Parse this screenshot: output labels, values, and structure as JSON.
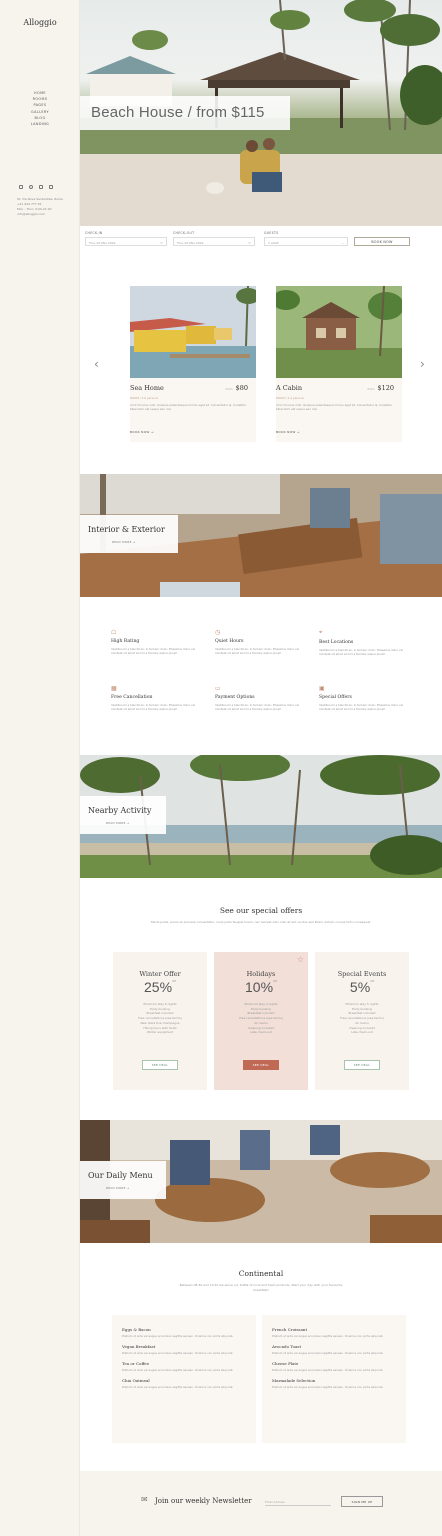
{
  "sidebar": {
    "logo": "Alloggio",
    "nav": [
      "HOME",
      "ROOMS",
      "PAGES",
      "GALLERY",
      "BLOG",
      "LANDING"
    ],
    "social_icons": [
      "instagram-icon",
      "tripadvisor-icon",
      "facebook-icon",
      "youtube-icon"
    ],
    "contact": [
      "St. Via Nova Santantika, Rome",
      "+41 944 777 45",
      "Mon - Thur: 9:00-21:00",
      "info@alloggio.com"
    ]
  },
  "hero": {
    "title": "Beach House / from $115"
  },
  "booking": {
    "checkin_label": "CHECK-IN",
    "checkin_value": "Thu, 20 Mar 2022",
    "checkout_label": "CHECK-OUT",
    "checkout_value": "Thu, 20 Mar 2022",
    "guests_label": "GUESTS",
    "guests_value": "1 Adult",
    "book_button": "BOOK NOW"
  },
  "rooms": [
    {
      "name": "Sea Home",
      "from": "from",
      "price": "$80",
      "meta": "ROOM / 4-6 persons",
      "desc": "Id ut rhoncus odio. Quisque pellentesque mil leo eget sit. Consectetur qi. Curabitur bibendum est neque aen nisi.",
      "book": "BOOK NOW →"
    },
    {
      "name": "A Cabin",
      "from": "from",
      "price": "$120",
      "meta": "ROOM / 2-4 persons",
      "desc": "Id ut rhoncus odio. Quisque pellentesque mil leo eget sit. Consectetur qi. Curabitur bibendum est neque aen nisi.",
      "book": "BOOK NOW →"
    }
  ],
  "banners": {
    "interior": {
      "title": "Interior & Exterior",
      "link": "READ MORE →"
    },
    "activity": {
      "title": "Nearby Activity",
      "link": "READ MORE →"
    },
    "menu": {
      "title": "Our Daily Menu",
      "link": "READ MORE →"
    }
  },
  "features": [
    {
      "icon": "wifi-icon",
      "title": "High Rating",
      "desc": "Vestibulum a blandit ex, in tempor dolor. Phasellus dolor vel volutpat sit amet et mill a facilisis alique ipsum."
    },
    {
      "icon": "clock-icon",
      "title": "Quiet Hours",
      "desc": "Vestibulum a blandit ex, in tempor dolor. Phasellus dolor vel volutpat sit amet et mill a facilisis alique ipsum."
    },
    {
      "icon": "map-pin-icon",
      "title": "Best Locations",
      "desc": "Vestibulum a blandit ex, in tempor dolor. Phasellus dolor vel volutpat sit amet et mill a facilisis alique ipsum."
    },
    {
      "icon": "calendar-icon",
      "title": "Free Cancellation",
      "desc": "Vestibulum a blandit ex, in tempor dolor. Phasellus dolor vel volutpat sit amet et mill a facilisis alique ipsum."
    },
    {
      "icon": "card-icon",
      "title": "Payment Options",
      "desc": "Vestibulum a blandit ex, in tempor dolor. Phasellus dolor vel volutpat sit amet et mill a facilisis alique ipsum."
    },
    {
      "icon": "gift-icon",
      "title": "Special Offers",
      "desc": "Vestibulum a blandit ex, in tempor dolor. Phasellus dolor vel volutpat sit amet et mill a facilisis alique ipsum."
    }
  ],
  "offers_section": {
    "title": "See our special offers",
    "subtitle": "Morbi porta, purus et posuere consectetur, risus justo feugiat lorem, nec laoreet odio odio at est. Luctus sed libero dictum cursus tortu consequat."
  },
  "offers": [
    {
      "title": "Winter Offer",
      "percent": "25%",
      "off": "Off",
      "items": [
        "Minimum stay 6 nights",
        "Early booking",
        "Breakfast included",
        "Free cancellations (see terms)",
        "New Years Eve champagne",
        "Hiking tours with hosts",
        "Winter equipment"
      ],
      "button": "SEE DEAL"
    },
    {
      "title": "Holidays",
      "percent": "10%",
      "off": "Off",
      "items": [
        "Minimum stay 4 nights",
        "Early booking",
        "Breakfast included",
        "Free cancellations (see terms)",
        "All rooms",
        "Cleaning included",
        "Late check-out"
      ],
      "button": "SEE DEAL"
    },
    {
      "title": "Special Events",
      "percent": "5%",
      "off": "Off",
      "items": [
        "Minimum stay 5 nights",
        "Early booking",
        "Breakfast included",
        "Free cancellations (see terms)",
        "All rooms",
        "Cleaning included",
        "Late check-out"
      ],
      "button": "SEE DEAL"
    }
  ],
  "menu_section": {
    "title": "Continental",
    "subtitle": "Between 08.30 and 10.30 we serve our buffet of local and fresh products. Start your day with your favourite breakfast!"
  },
  "menu_items": [
    {
      "name": "Eggs & Bacon",
      "desc": "Pretium ut ante vel augue accumsan sagittis aenean. Vivamus non porta aliqu lab."
    },
    {
      "name": "French Croissant",
      "desc": "Pretium ut ante vel augue accumsan sagittis aenean. Vivamus non porta aliqu lab."
    },
    {
      "name": "Vegan Breakfast",
      "desc": "Pretium ut ante vel augue accumsan sagittis aenean. Vivamus non porta aliqu lab."
    },
    {
      "name": "Avocado Toast",
      "desc": "Pretium ut ante vel augue accumsan sagittis aenean. Vivamus non porta aliqu lab."
    },
    {
      "name": "Tea or Coffee",
      "desc": "Pretium ut ante vel augue accumsan sagittis aenean. Vivamus non porta aliqu lab."
    },
    {
      "name": "Cheese Plate",
      "desc": "Pretium ut ante vel augue accumsan sagittis aenean. Vivamus non porta aliqu lab."
    },
    {
      "name": "Chia Oatmeal",
      "desc": "Pretium ut ante vel augue accumsan sagittis aenean. Vivamus non porta aliqu lab."
    },
    {
      "name": "Marmalade Selection",
      "desc": "Pretium ut ante vel augue accumsan sagittis aenean. Vivamus non porta aliqu lab."
    }
  ],
  "newsletter": {
    "icon": "envelope-icon",
    "title": "Join our weekly Newsletter",
    "placeholder": "Email Address",
    "button": "SIGN ME UP"
  },
  "colors": {
    "accent": "#c06a55",
    "green": "#5f8a6e",
    "cream": "#f7f4ee"
  }
}
